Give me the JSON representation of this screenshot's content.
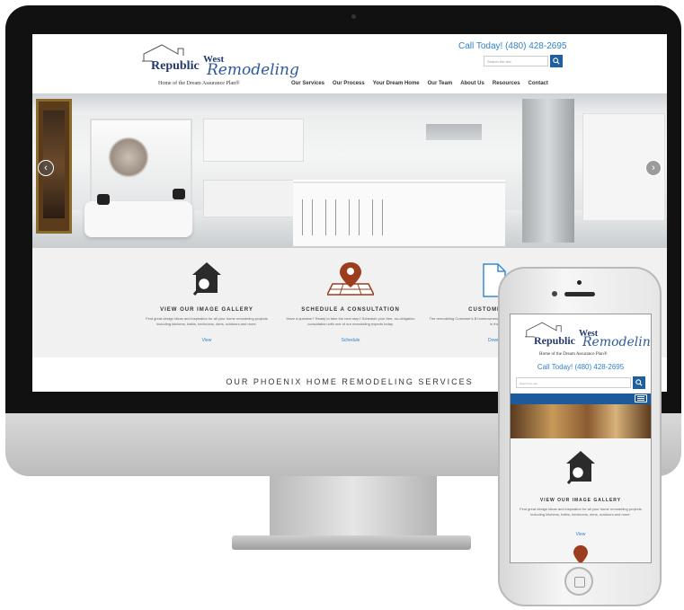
{
  "site": {
    "logo": {
      "republic": "Republic",
      "west": "West",
      "remodeling": "Remodeling",
      "tagline": "Home of the Dream Assurance Plan®"
    },
    "call": "Call Today! (480) 428-2695",
    "search_placeholder": "Search the site",
    "nav": [
      "Our Services",
      "Our Process",
      "Your Dream Home",
      "Our Team",
      "About Us",
      "Resources",
      "Contact"
    ],
    "features": [
      {
        "title": "VIEW OUR IMAGE GALLERY",
        "desc": "Find great design ideas and inspiration for all your home remodeling projects including kitchens, baths, bedrooms, dens, outdoors and more.",
        "link": "View"
      },
      {
        "title": "SCHEDULE A CONSULTATION",
        "desc": "Have a question? Ready to take the next step? Schedule your free, no-obligation consultation with one of our remodeling experts today.",
        "link": "Schedule"
      },
      {
        "title": "CUSTOMER'S B",
        "desc": "The remodeling Customer's B homeowners who have come to that is as prevalent in the",
        "link": "Downl"
      }
    ],
    "services_title": "OUR PHOENIX HOME REMODELING SERVICES"
  },
  "icons": {
    "gallery": "house-magnifier-icon",
    "consult": "map-pin-icon",
    "guide": "document-icon",
    "search": "search-icon",
    "menu": "hamburger-icon",
    "prev": "chevron-left-icon",
    "next": "chevron-right-icon"
  },
  "colors": {
    "accent_blue": "#2f82c9",
    "nav_blue": "#1c5a9c",
    "pin_brown": "#9b3d1e"
  }
}
